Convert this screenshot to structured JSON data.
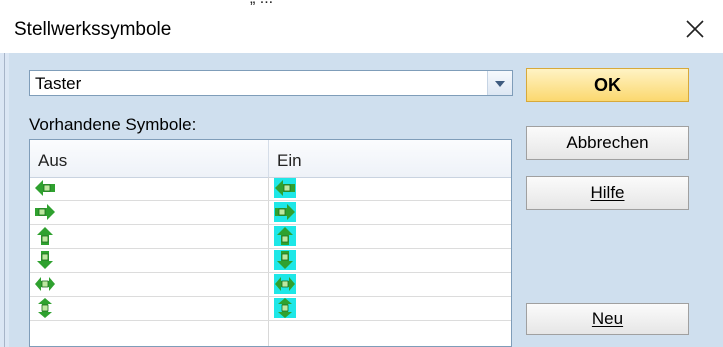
{
  "fragment": "„ ...",
  "window": {
    "title": "Stellwerkssymbole",
    "close_glyph": "✕"
  },
  "combo": {
    "value": "Taster"
  },
  "labels": {
    "symbols": "Vorhandene Symbole:"
  },
  "list": {
    "columns": [
      "Aus",
      "Ein"
    ],
    "rows": [
      {
        "icon": "arrow-left-icon"
      },
      {
        "icon": "arrow-right-icon"
      },
      {
        "icon": "arrow-up-icon"
      },
      {
        "icon": "arrow-down-icon"
      },
      {
        "icon": "arrow-left-right-icon"
      },
      {
        "icon": "arrow-up-down-icon"
      }
    ],
    "highlight_color": "#1ee7e7",
    "symbol_color": "#2fa12f"
  },
  "buttons": {
    "ok": "OK",
    "cancel": "Abbrechen",
    "help": "Hilfe",
    "new": "Neu"
  }
}
